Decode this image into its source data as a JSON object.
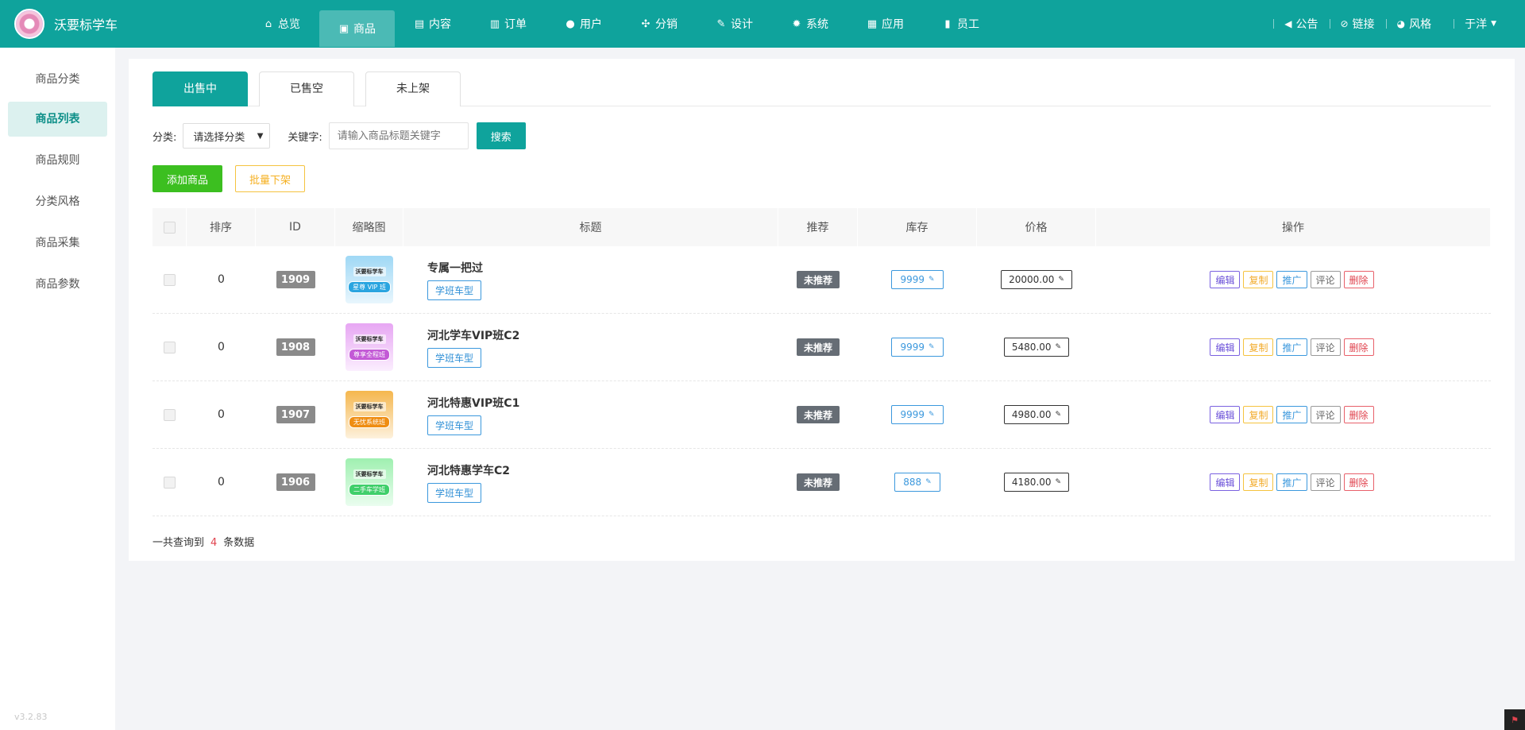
{
  "app": {
    "title": "沃要标学车",
    "version": "v3.2.83"
  },
  "nav": [
    {
      "label": "总览",
      "icon": "home-icon",
      "glyph": "⌂"
    },
    {
      "label": "商品",
      "icon": "bag-icon",
      "glyph": "▣"
    },
    {
      "label": "内容",
      "icon": "document-icon",
      "glyph": "▤"
    },
    {
      "label": "订单",
      "icon": "clipboard-icon",
      "glyph": "▥"
    },
    {
      "label": "用户",
      "icon": "user-icon",
      "glyph": "●"
    },
    {
      "label": "分销",
      "icon": "share-icon",
      "glyph": "✣"
    },
    {
      "label": "设计",
      "icon": "paint-icon",
      "glyph": "✎"
    },
    {
      "label": "系统",
      "icon": "gear-icon",
      "glyph": "✹"
    },
    {
      "label": "应用",
      "icon": "grid-icon",
      "glyph": "▦"
    },
    {
      "label": "员工",
      "icon": "lock-icon",
      "glyph": "▮"
    }
  ],
  "top_right": {
    "notice": "公告",
    "link": "链接",
    "style": "风格",
    "user": "于洋"
  },
  "sidebar": [
    {
      "label": "商品分类"
    },
    {
      "label": "商品列表"
    },
    {
      "label": "商品规则"
    },
    {
      "label": "分类风格"
    },
    {
      "label": "商品采集"
    },
    {
      "label": "商品参数"
    }
  ],
  "tabs": [
    {
      "label": "出售中"
    },
    {
      "label": "已售空"
    },
    {
      "label": "未上架"
    }
  ],
  "filter": {
    "category_label": "分类:",
    "category_value": "请选择分类",
    "keyword_label": "关键字:",
    "keyword_placeholder": "请输入商品标题关键字",
    "search_button": "搜索"
  },
  "buttons": {
    "add": "添加商品",
    "batch_off": "批量下架"
  },
  "table": {
    "headers": [
      "排序",
      "ID",
      "缩略图",
      "标题",
      "推荐",
      "库存",
      "价格",
      "操作"
    ],
    "rows": [
      {
        "sort": "0",
        "id": "1909",
        "thumb_text": "星尊 VIP 班",
        "thumb_brand": "沃要标学车",
        "title": "专属一把过",
        "tag": "学班车型",
        "recommend": "未推荐",
        "stock": "9999",
        "price": "20000.00"
      },
      {
        "sort": "0",
        "id": "1908",
        "thumb_text": "尊享全程班",
        "thumb_brand": "沃要标学车",
        "title": "河北学车VIP班C2",
        "tag": "学班车型",
        "recommend": "未推荐",
        "stock": "9999",
        "price": "5480.00"
      },
      {
        "sort": "0",
        "id": "1907",
        "thumb_text": "无忧系统班",
        "thumb_brand": "沃要标学车",
        "title": "河北特惠VIP班C1",
        "tag": "学班车型",
        "recommend": "未推荐",
        "stock": "9999",
        "price": "4980.00"
      },
      {
        "sort": "0",
        "id": "1906",
        "thumb_text": "二手车学班",
        "thumb_brand": "沃要标学车",
        "title": "河北特惠学车C2",
        "tag": "学班车型",
        "recommend": "未推荐",
        "stock": "888",
        "price": "4180.00"
      }
    ],
    "ops": {
      "edit": "编辑",
      "copy": "复制",
      "promo": "推广",
      "comment": "评论",
      "delete": "删除"
    }
  },
  "summary": {
    "prefix": "一共查询到",
    "count": "4",
    "suffix": "条数据"
  },
  "colors": {
    "primary": "#0fa39c",
    "add": "#3cbf20",
    "warning": "#f5c33f",
    "danger": "#e0434e",
    "info": "#3b98dd"
  }
}
